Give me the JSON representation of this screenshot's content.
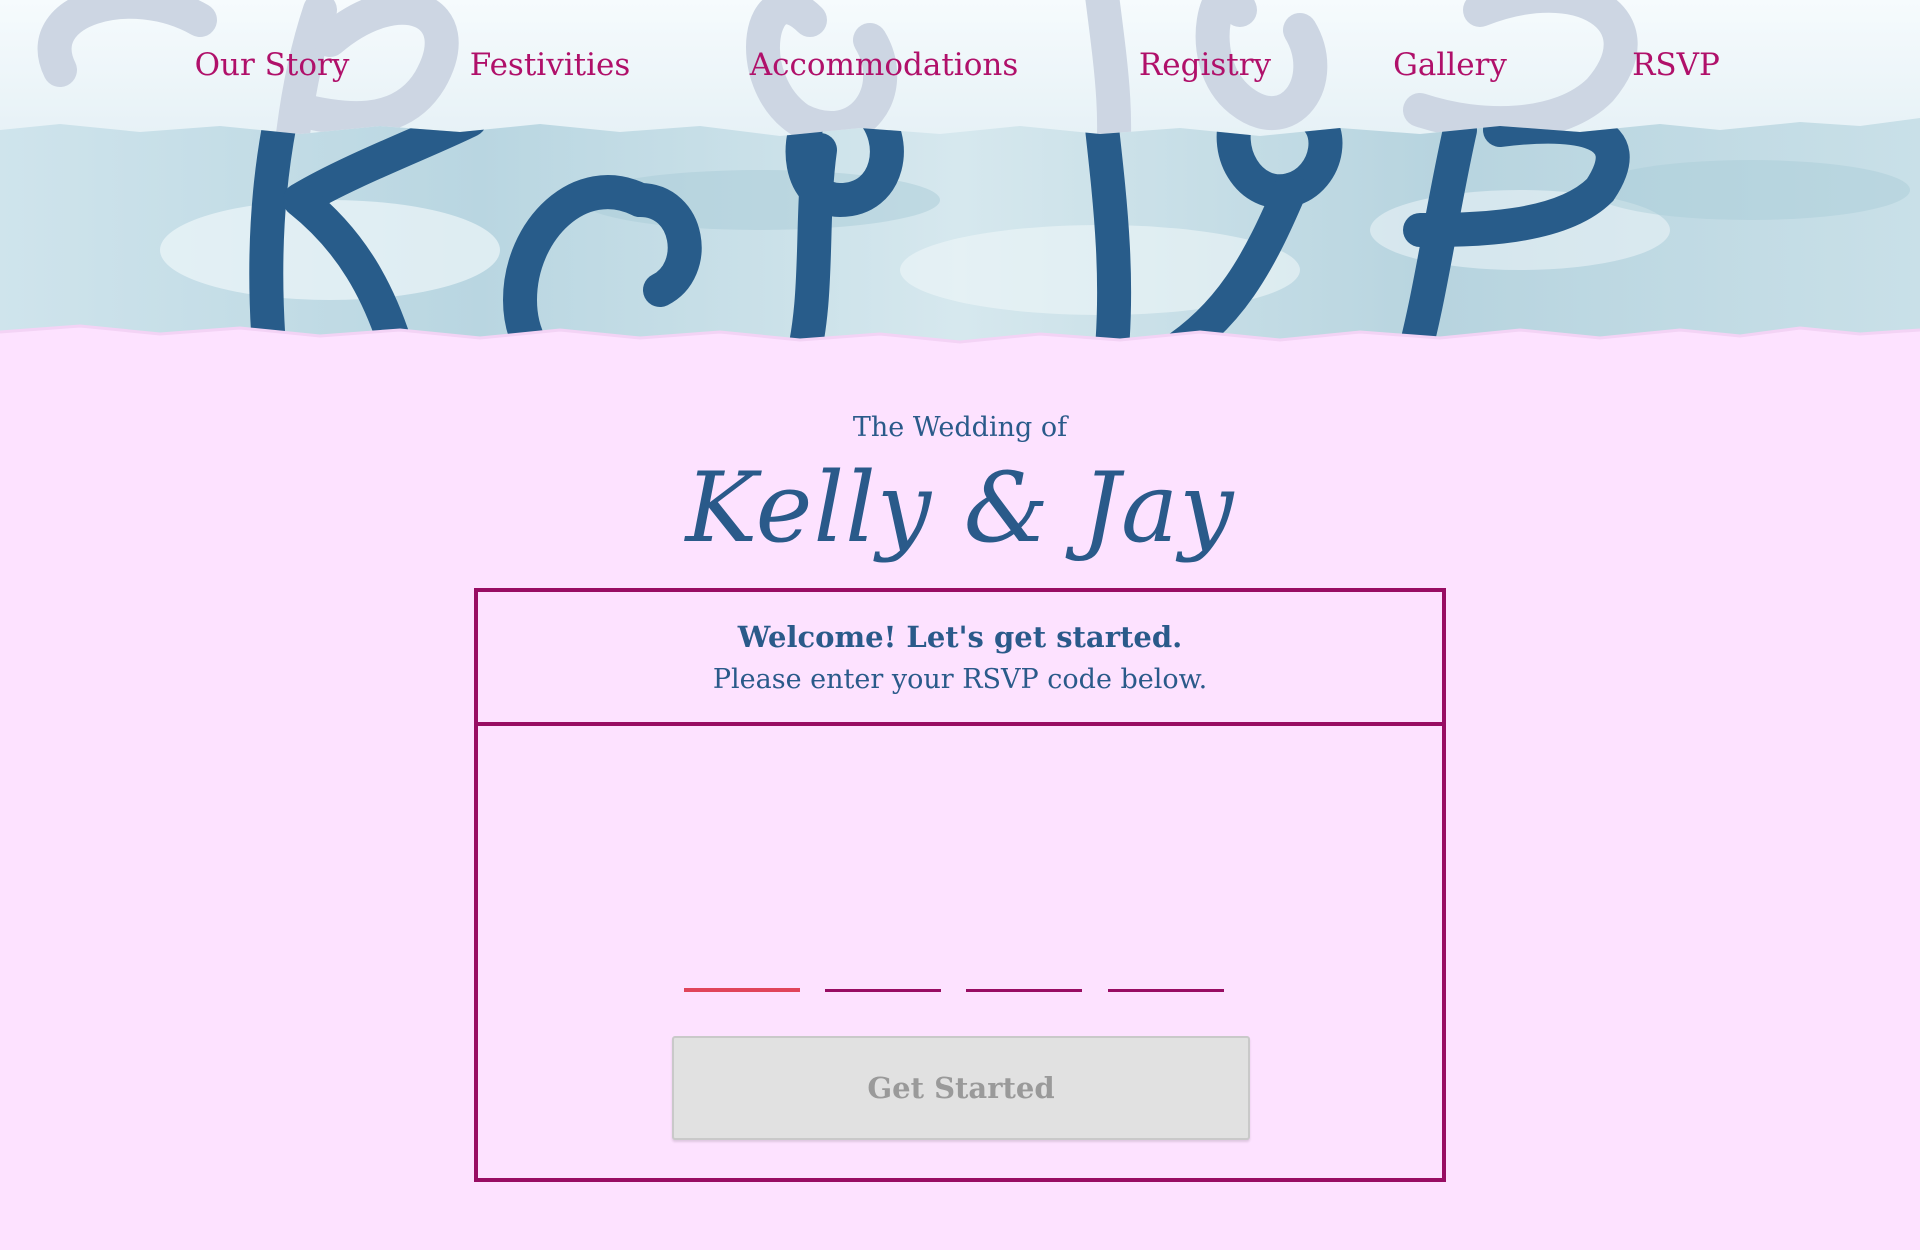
{
  "nav": {
    "items": [
      {
        "label": "Our Story"
      },
      {
        "label": "Festivities"
      },
      {
        "label": "Accommodations"
      },
      {
        "label": "Registry"
      },
      {
        "label": "Gallery"
      },
      {
        "label": "RSVP"
      }
    ]
  },
  "hero": {
    "title": "RSVP"
  },
  "header": {
    "subtitle": "The Wedding of",
    "couple": "Kelly & Jay"
  },
  "card": {
    "welcome": "Welcome! Let's get started.",
    "instructions": "Please enter your RSVP code below.",
    "code_inputs": [
      {
        "value": ""
      },
      {
        "value": ""
      },
      {
        "value": ""
      },
      {
        "value": ""
      }
    ],
    "button_label": "Get Started"
  },
  "colors": {
    "page_background": "#fde2ff",
    "nav_link": "#b0106a",
    "brand_blue": "#2a5a8a",
    "card_border": "#980d63",
    "active_input_underline": "#e0455a",
    "button_disabled": "#e1e1e1"
  }
}
